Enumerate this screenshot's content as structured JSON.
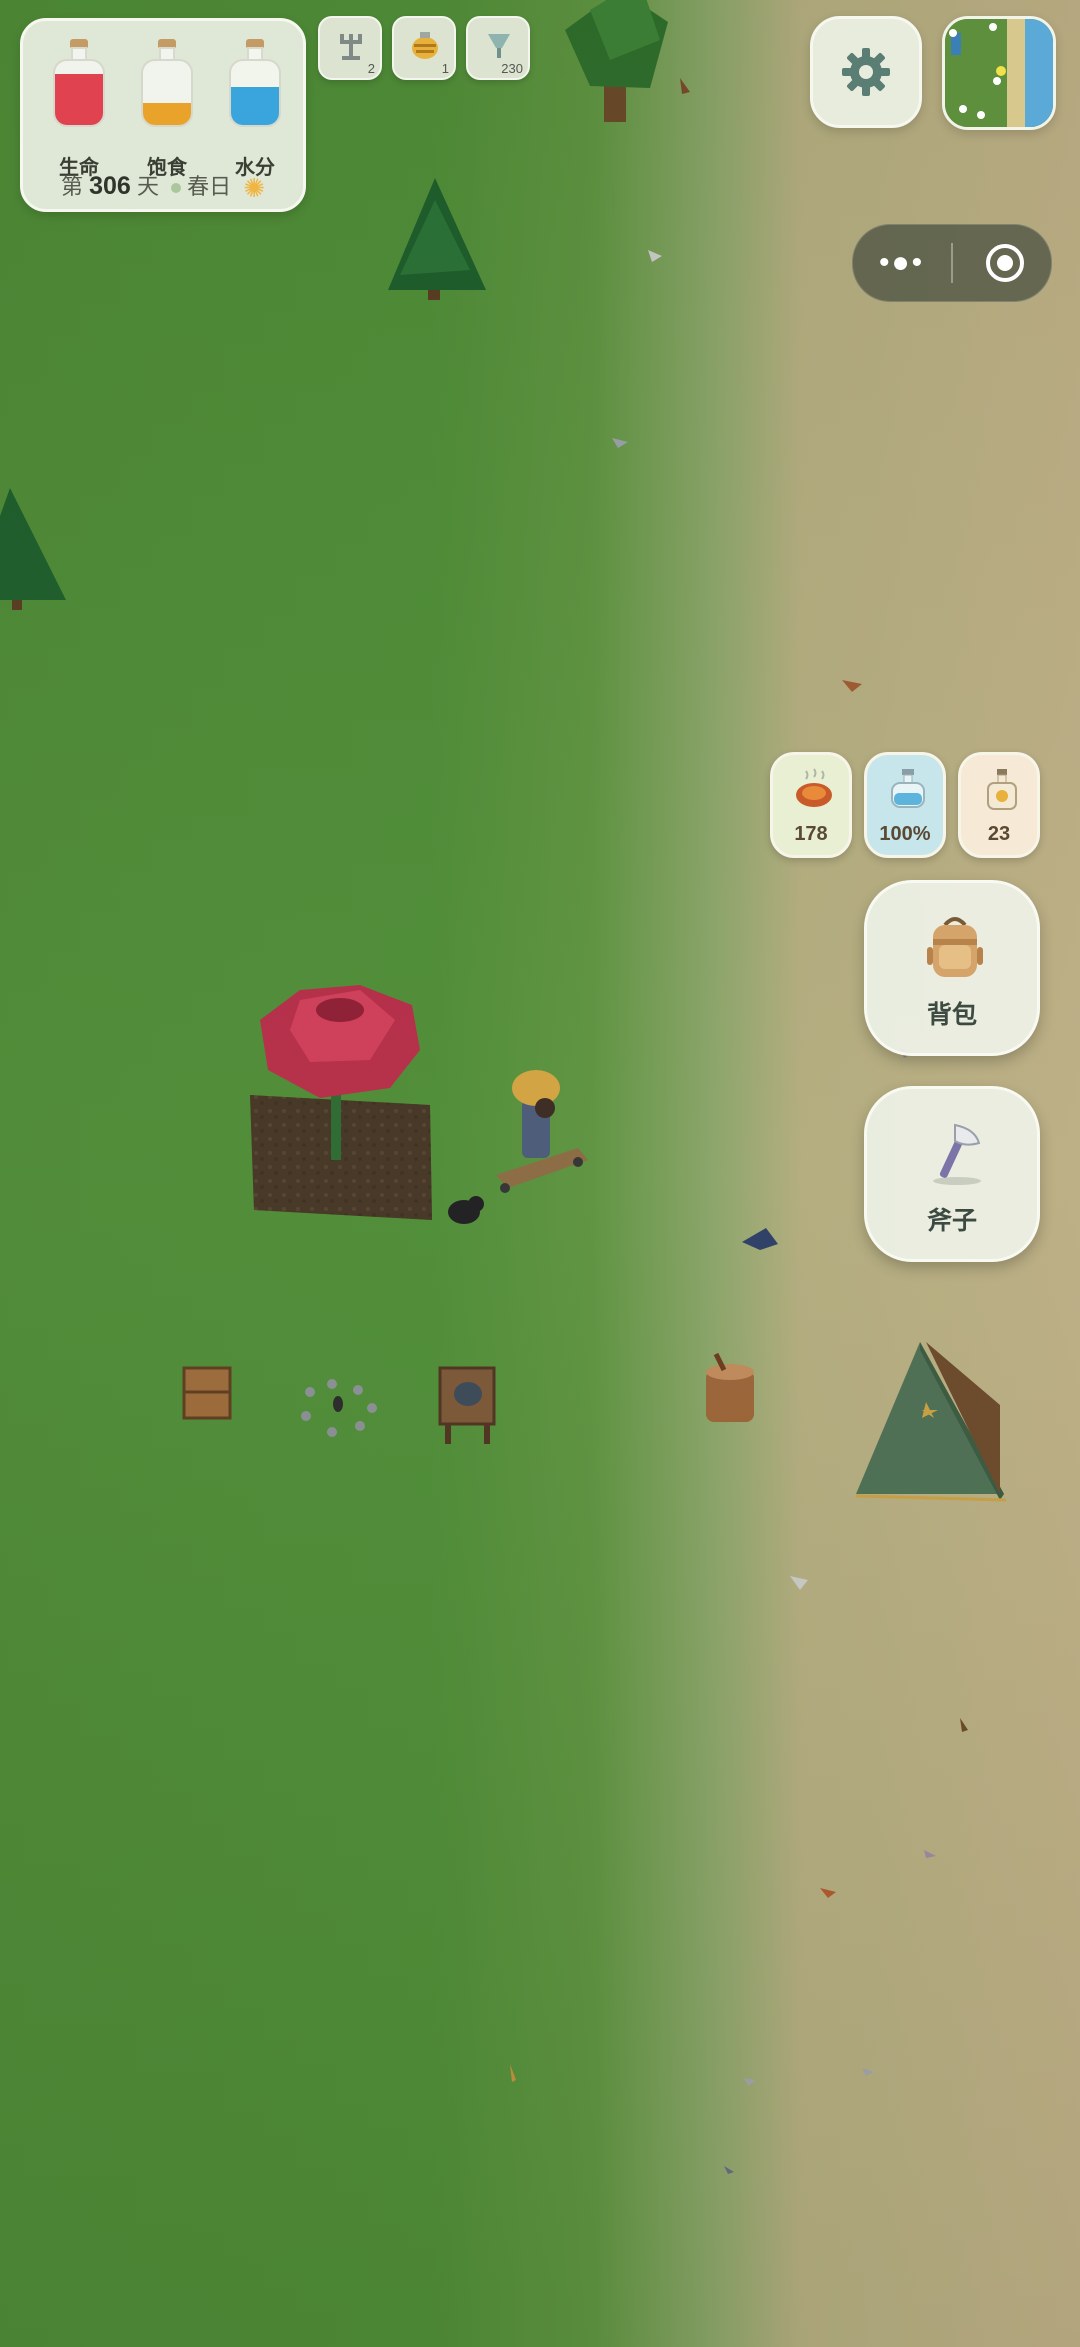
{
  "hud": {
    "stats": [
      {
        "label": "生命",
        "color": "#e0434f",
        "level": 0.8
      },
      {
        "label": "饱食",
        "color": "#e9a22a",
        "level": 0.35
      },
      {
        "label": "水分",
        "color": "#3aa4dc",
        "level": 0.6
      }
    ],
    "day_prefix": "第",
    "day_number": "306",
    "day_suffix": "天",
    "season": "春日",
    "weather_icon": "sun-icon"
  },
  "toolbar": [
    {
      "icon": "scarecrow-icon",
      "count": "2"
    },
    {
      "icon": "beehive-icon",
      "count": "1"
    },
    {
      "icon": "funnel-icon",
      "count": "230"
    }
  ],
  "settings_icon": "gear-icon",
  "minimap_icon": "minimap",
  "capsule": {
    "more_label": "•●•",
    "target_icon": "target-icon"
  },
  "resources": [
    {
      "icon": "roast-meat-icon",
      "value": "178",
      "bg": "#e9efd3"
    },
    {
      "icon": "water-bottle-icon",
      "value": "100%",
      "bg": "#c6e6ec"
    },
    {
      "icon": "oil-bottle-icon",
      "value": "23",
      "bg": "#f6ead6"
    }
  ],
  "actions": {
    "backpack_label": "背包",
    "axe_label": "斧子"
  }
}
